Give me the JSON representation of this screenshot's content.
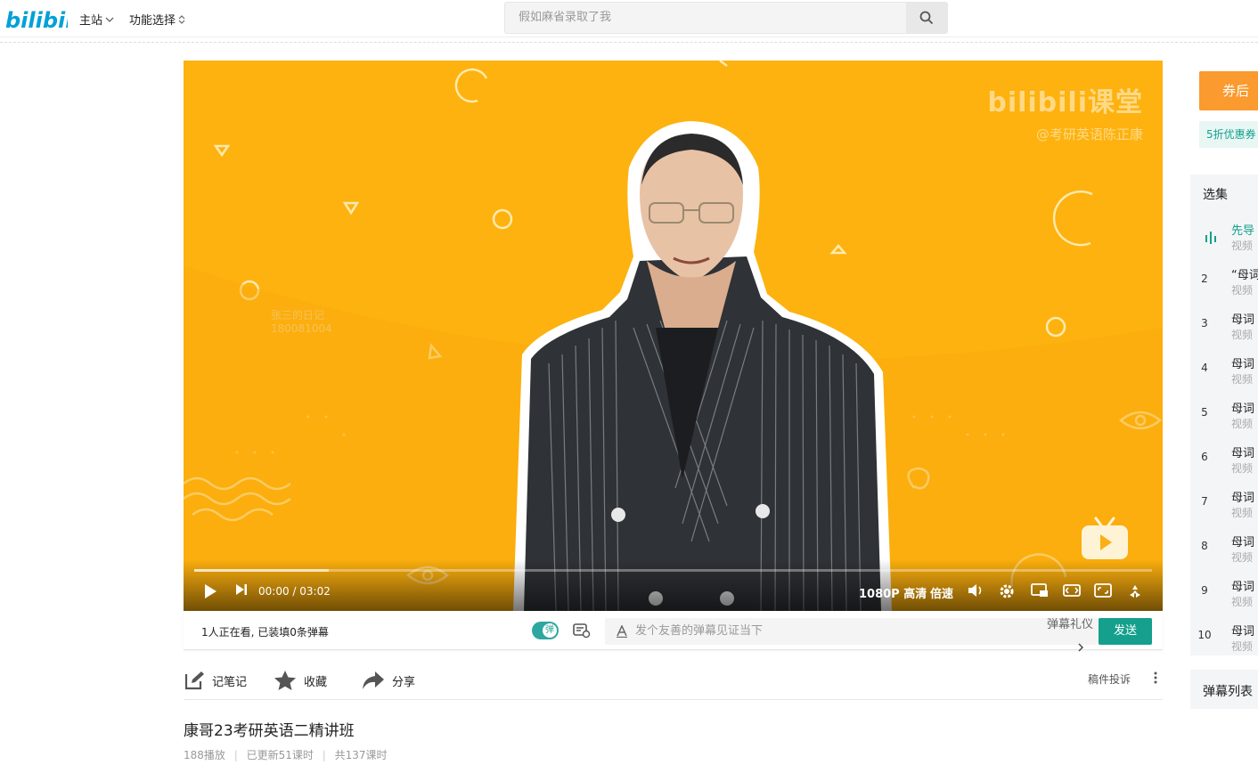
{
  "header": {
    "logo_text": "bilibili",
    "nav_main": "主站",
    "nav_feature": "功能选择",
    "search_placeholder": "假如麻省录取了我"
  },
  "player": {
    "brand_text": "bilibili课堂",
    "brand_author": "@考研英语陈正康",
    "current_time": "00:00",
    "duration": "03:02",
    "time_display": "00:00 / 03:02",
    "progress_fraction": 0.14,
    "quality_label": "1080P 高清",
    "speed_label": "倍速"
  },
  "danmaku_bar": {
    "viewers_text": "1人正在看, 已装填0条弹幕",
    "toggle_label": "弹",
    "input_placeholder": "发个友善的弹幕见证当下",
    "etiquette_label": "弹幕礼仪",
    "send_label": "发送"
  },
  "actions": {
    "note_label": "记笔记",
    "favorite_label": "收藏",
    "share_label": "分享",
    "report_label": "稿件投诉"
  },
  "course": {
    "title": "康哥23考研英语二精讲班",
    "plays": "188播放",
    "updated": "已更新51课时",
    "total": "共137课时"
  },
  "sidebar": {
    "coupon_label": "券后",
    "coupon_sub": "5折优惠券",
    "playlist_title": "选集",
    "items": [
      {
        "num": "",
        "title": "先导",
        "sub": "视频"
      },
      {
        "num": "2",
        "title": "“母词",
        "sub": "视频"
      },
      {
        "num": "3",
        "title": "母词",
        "sub": "视频"
      },
      {
        "num": "4",
        "title": "母词",
        "sub": "视频"
      },
      {
        "num": "5",
        "title": "母词",
        "sub": "视频"
      },
      {
        "num": "6",
        "title": "母词",
        "sub": "视频"
      },
      {
        "num": "7",
        "title": "母词",
        "sub": "视频"
      },
      {
        "num": "8",
        "title": "母词",
        "sub": "视频"
      },
      {
        "num": "9",
        "title": "母词",
        "sub": "视频"
      },
      {
        "num": "10",
        "title": "母词",
        "sub": "视频"
      }
    ],
    "danmaku_list_label": "弹幕列表"
  },
  "colors": {
    "accent_teal": "#14a08c",
    "bili_blue": "#00a1d6",
    "player_bg": "#fdb20f",
    "coupon_orange": "#fb9a2e"
  }
}
